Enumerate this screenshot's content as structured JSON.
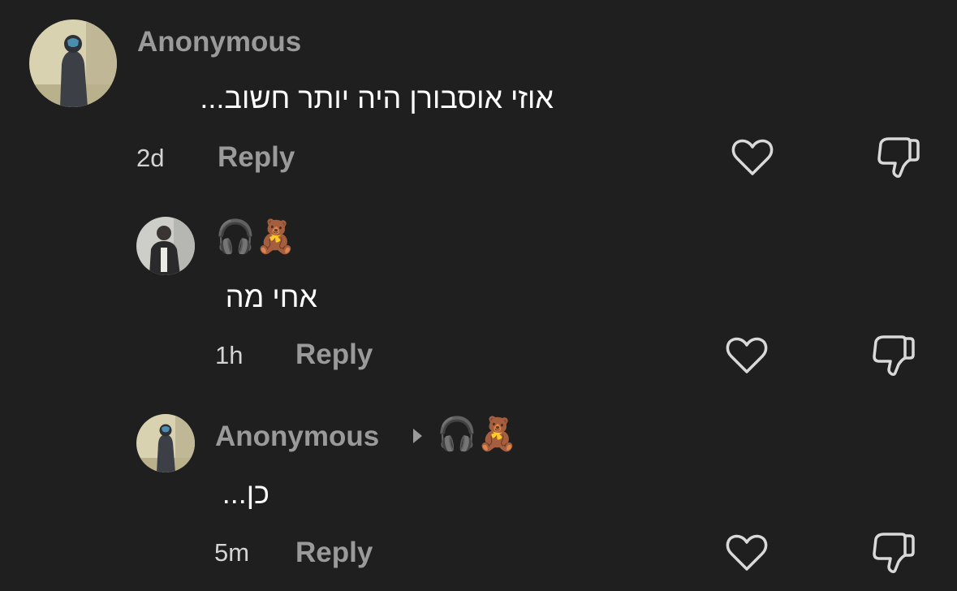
{
  "comments": [
    {
      "username": "Anonymous",
      "text": "אוזי אוסבורן היה יותר חשוב...",
      "time": "2d",
      "reply_label": "Reply"
    },
    {
      "username_emoji": "🎧🧸",
      "text": "אחי מה",
      "time": "1h",
      "reply_label": "Reply"
    },
    {
      "username": "Anonymous",
      "replying_to_emoji": "🎧🧸",
      "text": "כן...",
      "time": "5m",
      "reply_label": "Reply"
    }
  ],
  "icons": {
    "like": "heart-icon",
    "dislike": "thumbs-down-icon",
    "reply_caret": "caret-right-icon"
  },
  "colors": {
    "background": "#1f1f1f",
    "muted_text": "#9a9a9a",
    "primary_text": "#ffffff",
    "icon_stroke": "#d9d9d9"
  }
}
